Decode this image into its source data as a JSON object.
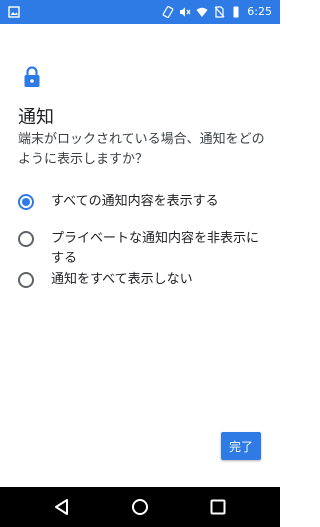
{
  "status_bar": {
    "time": "6:25",
    "icons": [
      "image-icon",
      "screen-rotation-icon",
      "mute-icon",
      "wifi-icon",
      "no-sim-icon",
      "battery-icon"
    ]
  },
  "header": {
    "icon": "lock-icon",
    "title": "通知",
    "description": "端末がロックされている場合、通知をどのように表示しますか？"
  },
  "options": [
    {
      "label": "すべての通知内容を表示する",
      "selected": true
    },
    {
      "label": "プライベートな通知内容を非表示にする",
      "selected": false
    },
    {
      "label": "通知をすべて表示しない",
      "selected": false
    }
  ],
  "actions": {
    "done_label": "完了"
  },
  "nav": {
    "icons": [
      "back-icon",
      "home-icon",
      "recents-icon"
    ]
  },
  "colors": {
    "accent": "#2f7be6",
    "status_bar": "#2f7be6",
    "nav_bar": "#000000"
  }
}
